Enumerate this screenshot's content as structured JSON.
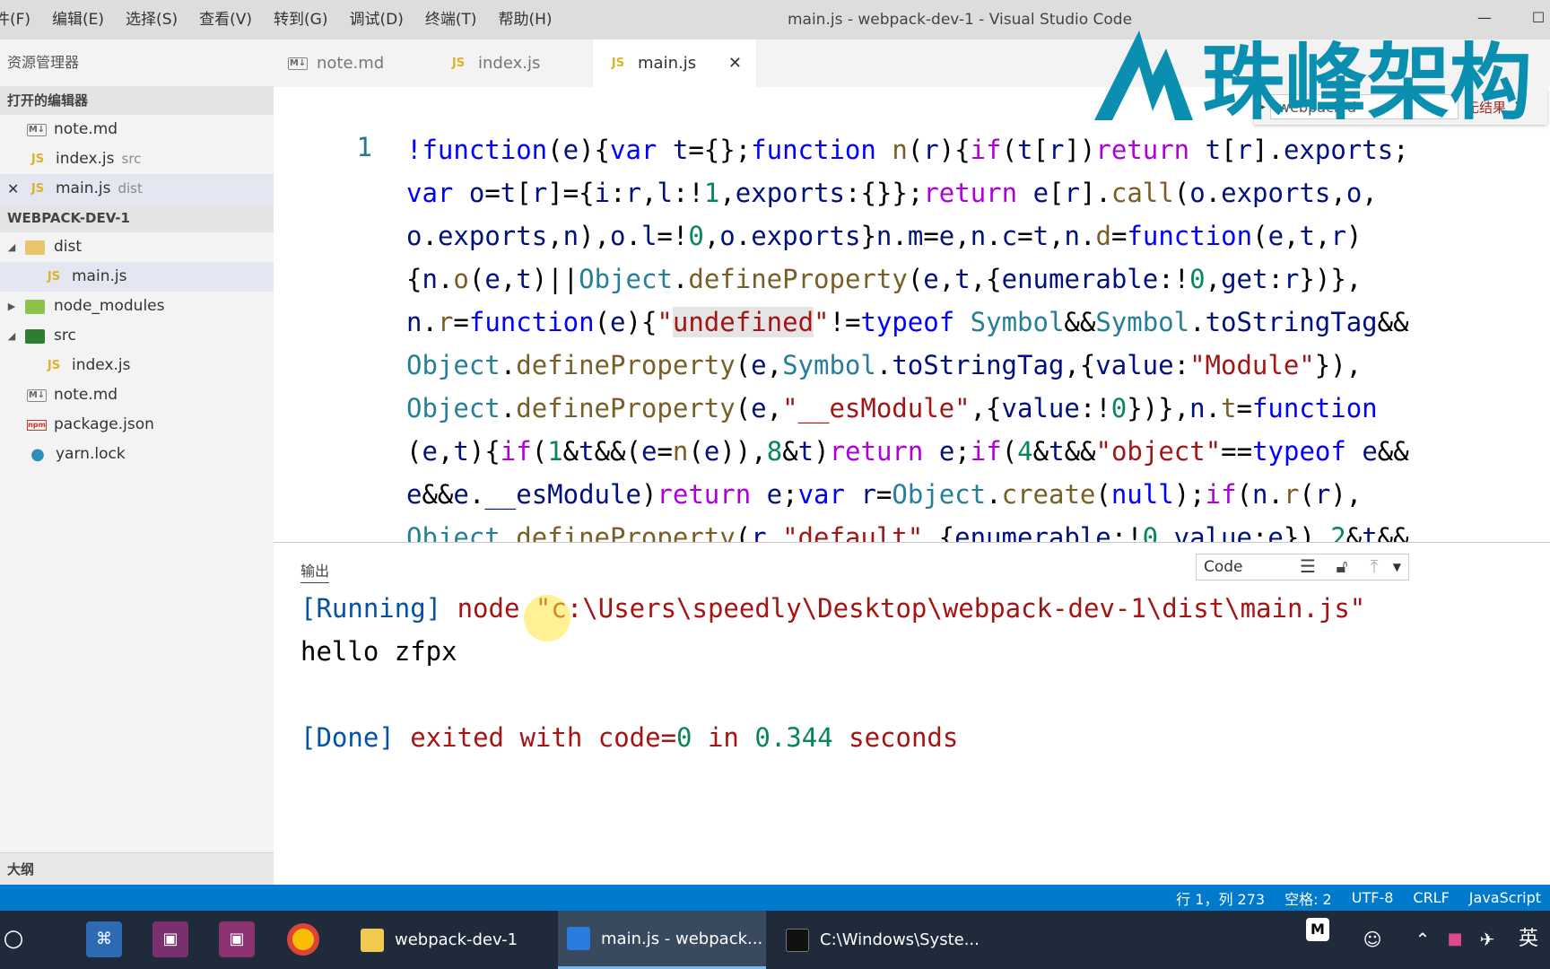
{
  "menu": [
    "件(F)",
    "编辑(E)",
    "选择(S)",
    "查看(V)",
    "转到(G)",
    "调试(D)",
    "终端(T)",
    "帮助(H)"
  ],
  "window_title": "main.js - webpack-dev-1 - Visual Studio Code",
  "window_controls": {
    "minimize": "—",
    "maximize": "☐"
  },
  "sidebar": {
    "header": "资源管理器",
    "open_editors_title": "打开的编辑器",
    "open_editors": [
      {
        "icon": "M↓",
        "name": "note.md",
        "desc": ""
      },
      {
        "icon": "JS",
        "name": "index.js",
        "desc": "src"
      },
      {
        "icon": "JS",
        "name": "main.js",
        "desc": "dist"
      }
    ],
    "workspace_title": "WEBPACK-DEV-1",
    "tree": {
      "dist": "dist",
      "dist_main": "main.js",
      "node_modules": "node_modules",
      "src": "src",
      "src_index": "index.js",
      "note": "note.md",
      "package": "package.json",
      "yarn": "yarn.lock"
    },
    "outline_title": "大纲"
  },
  "tabs": [
    {
      "icon": "M↓",
      "label": "note.md"
    },
    {
      "icon": "JS",
      "label": "index.js"
    },
    {
      "icon": "JS",
      "label": "main.js"
    }
  ],
  "find_widget": {
    "query": "webpack-d",
    "result": "无结果"
  },
  "editor": {
    "line_number": "1"
  },
  "output": {
    "panel_title": "输出",
    "channel": "Code",
    "running_tag": "[Running]",
    "command": " node \"c:\\Users\\speedly\\Desktop\\webpack-dev-1\\dist\\main.js\"",
    "stdout": "hello zfpx",
    "done_tag": "[Done]",
    "exit_msg_1": " exited with code=",
    "exit_code": "0",
    "exit_msg_2": " in ",
    "duration": "0.344",
    "exit_msg_3": " seconds"
  },
  "status_bar": [
    "行 1，列 273",
    "空格: 2",
    "UTF-8",
    "CRLF",
    "JavaScript"
  ],
  "taskbar": {
    "apps": [
      {
        "label": "webpack-dev-1"
      },
      {
        "label": "main.js - webpack..."
      },
      {
        "label": "C:\\Windows\\Syste..."
      }
    ],
    "ime": "英"
  },
  "watermark": {
    "text": "珠峰架构"
  },
  "colors": {
    "accent": "#007acc",
    "taskbar": "#1f2a3a",
    "sidebar": "#f3f3f3"
  }
}
